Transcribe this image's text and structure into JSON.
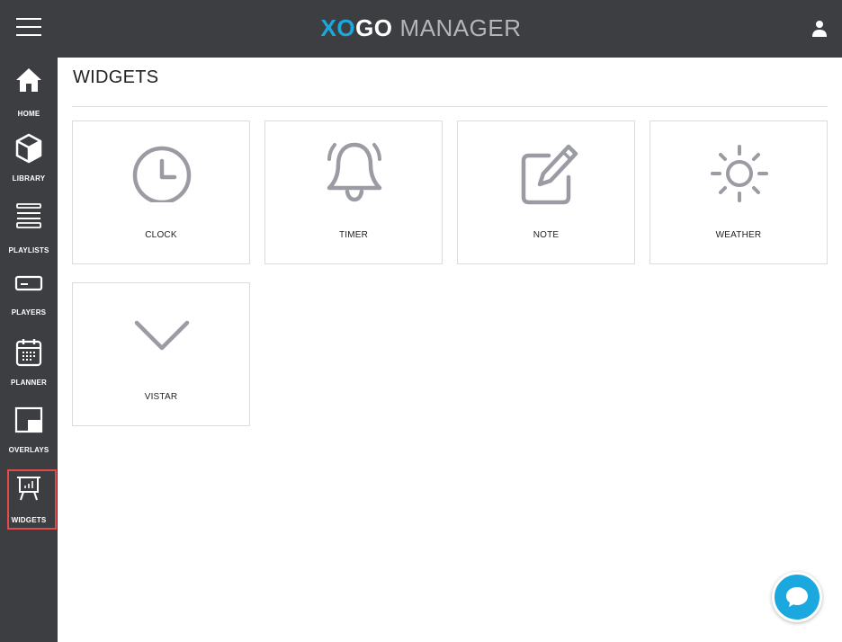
{
  "header": {
    "logo_x": "XO",
    "logo_go": "GO",
    "app_name": "MANAGER"
  },
  "sidebar": {
    "items": [
      {
        "label": "HOME",
        "icon": "home-icon"
      },
      {
        "label": "LIBRARY",
        "icon": "cube-icon"
      },
      {
        "label": "PLAYLISTS",
        "icon": "list-icon"
      },
      {
        "label": "PLAYERS",
        "icon": "player-icon"
      },
      {
        "label": "PLANNER",
        "icon": "calendar-icon"
      },
      {
        "label": "OVERLAYS",
        "icon": "overlay-icon"
      },
      {
        "label": "WIDGETS",
        "icon": "presentation-chart-icon",
        "active": true
      }
    ]
  },
  "main": {
    "title": "WIDGETS",
    "widgets": [
      {
        "label": "CLOCK",
        "icon": "clock-icon"
      },
      {
        "label": "TIMER",
        "icon": "bell-icon"
      },
      {
        "label": "NOTE",
        "icon": "edit-icon"
      },
      {
        "label": "WEATHER",
        "icon": "sun-icon"
      },
      {
        "label": "VISTAR",
        "icon": "chevron-down-icon"
      }
    ]
  },
  "colors": {
    "accent": "#1aa8de",
    "sidebar_bg": "#3d3e42",
    "active_border": "#e34a4a",
    "icon_gray": "#9a9ba3"
  }
}
